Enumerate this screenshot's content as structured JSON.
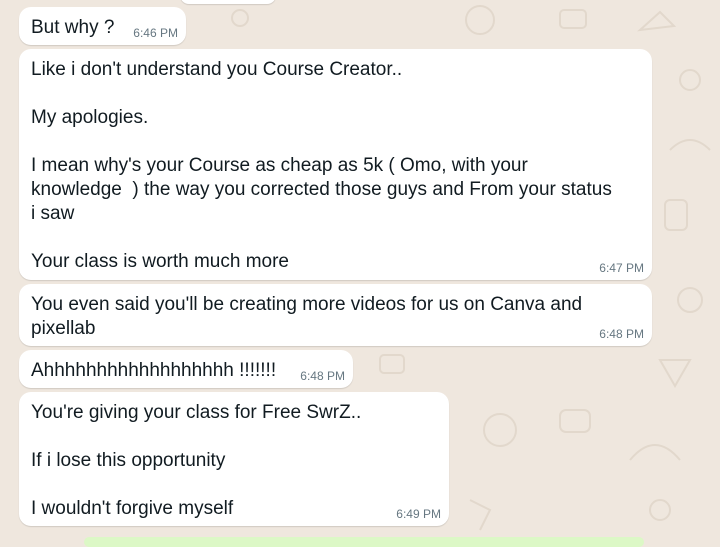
{
  "theme": {
    "chat_background": "#efe7de",
    "bubble_incoming": "#ffffff",
    "bubble_outgoing": "#dcf8c6",
    "timestamp_color": "#667781",
    "text_color": "#111b21"
  },
  "messages": [
    {
      "text": "But why ?",
      "time": "6:46 PM"
    },
    {
      "text": "Like i don't understand you Course Creator..\n\nMy apologies.\n\nI mean why's your Course as cheap as 5k ( Omo, with your\nknowledge  ) the way you corrected those guys and From your status\ni saw\n\nYour class is worth much more",
      "time": "6:47 PM"
    },
    {
      "text": "You even said you'll be creating more videos for us on Canva and\npixellab",
      "time": "6:48 PM"
    },
    {
      "text": "Ahhhhhhhhhhhhhhhhhh !!!!!!!",
      "time": "6:48 PM"
    },
    {
      "text": "You're giving your class for Free SwrZ..\n\nIf i lose this opportunity\n\nI wouldn't forgive myself",
      "time": "6:49 PM"
    }
  ]
}
